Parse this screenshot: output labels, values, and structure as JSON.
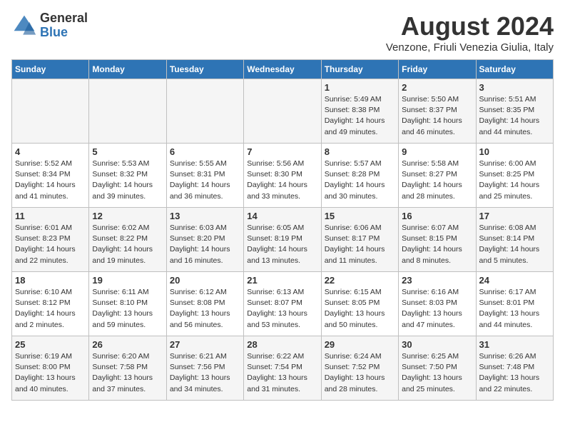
{
  "header": {
    "logo": {
      "line1": "General",
      "line2": "Blue"
    },
    "title": "August 2024",
    "location": "Venzone, Friuli Venezia Giulia, Italy"
  },
  "days_of_week": [
    "Sunday",
    "Monday",
    "Tuesday",
    "Wednesday",
    "Thursday",
    "Friday",
    "Saturday"
  ],
  "weeks": [
    [
      {
        "day": "",
        "info": ""
      },
      {
        "day": "",
        "info": ""
      },
      {
        "day": "",
        "info": ""
      },
      {
        "day": "",
        "info": ""
      },
      {
        "day": "1",
        "info": "Sunrise: 5:49 AM\nSunset: 8:38 PM\nDaylight: 14 hours\nand 49 minutes."
      },
      {
        "day": "2",
        "info": "Sunrise: 5:50 AM\nSunset: 8:37 PM\nDaylight: 14 hours\nand 46 minutes."
      },
      {
        "day": "3",
        "info": "Sunrise: 5:51 AM\nSunset: 8:35 PM\nDaylight: 14 hours\nand 44 minutes."
      }
    ],
    [
      {
        "day": "4",
        "info": "Sunrise: 5:52 AM\nSunset: 8:34 PM\nDaylight: 14 hours\nand 41 minutes."
      },
      {
        "day": "5",
        "info": "Sunrise: 5:53 AM\nSunset: 8:32 PM\nDaylight: 14 hours\nand 39 minutes."
      },
      {
        "day": "6",
        "info": "Sunrise: 5:55 AM\nSunset: 8:31 PM\nDaylight: 14 hours\nand 36 minutes."
      },
      {
        "day": "7",
        "info": "Sunrise: 5:56 AM\nSunset: 8:30 PM\nDaylight: 14 hours\nand 33 minutes."
      },
      {
        "day": "8",
        "info": "Sunrise: 5:57 AM\nSunset: 8:28 PM\nDaylight: 14 hours\nand 30 minutes."
      },
      {
        "day": "9",
        "info": "Sunrise: 5:58 AM\nSunset: 8:27 PM\nDaylight: 14 hours\nand 28 minutes."
      },
      {
        "day": "10",
        "info": "Sunrise: 6:00 AM\nSunset: 8:25 PM\nDaylight: 14 hours\nand 25 minutes."
      }
    ],
    [
      {
        "day": "11",
        "info": "Sunrise: 6:01 AM\nSunset: 8:23 PM\nDaylight: 14 hours\nand 22 minutes."
      },
      {
        "day": "12",
        "info": "Sunrise: 6:02 AM\nSunset: 8:22 PM\nDaylight: 14 hours\nand 19 minutes."
      },
      {
        "day": "13",
        "info": "Sunrise: 6:03 AM\nSunset: 8:20 PM\nDaylight: 14 hours\nand 16 minutes."
      },
      {
        "day": "14",
        "info": "Sunrise: 6:05 AM\nSunset: 8:19 PM\nDaylight: 14 hours\nand 13 minutes."
      },
      {
        "day": "15",
        "info": "Sunrise: 6:06 AM\nSunset: 8:17 PM\nDaylight: 14 hours\nand 11 minutes."
      },
      {
        "day": "16",
        "info": "Sunrise: 6:07 AM\nSunset: 8:15 PM\nDaylight: 14 hours\nand 8 minutes."
      },
      {
        "day": "17",
        "info": "Sunrise: 6:08 AM\nSunset: 8:14 PM\nDaylight: 14 hours\nand 5 minutes."
      }
    ],
    [
      {
        "day": "18",
        "info": "Sunrise: 6:10 AM\nSunset: 8:12 PM\nDaylight: 14 hours\nand 2 minutes."
      },
      {
        "day": "19",
        "info": "Sunrise: 6:11 AM\nSunset: 8:10 PM\nDaylight: 13 hours\nand 59 minutes."
      },
      {
        "day": "20",
        "info": "Sunrise: 6:12 AM\nSunset: 8:08 PM\nDaylight: 13 hours\nand 56 minutes."
      },
      {
        "day": "21",
        "info": "Sunrise: 6:13 AM\nSunset: 8:07 PM\nDaylight: 13 hours\nand 53 minutes."
      },
      {
        "day": "22",
        "info": "Sunrise: 6:15 AM\nSunset: 8:05 PM\nDaylight: 13 hours\nand 50 minutes."
      },
      {
        "day": "23",
        "info": "Sunrise: 6:16 AM\nSunset: 8:03 PM\nDaylight: 13 hours\nand 47 minutes."
      },
      {
        "day": "24",
        "info": "Sunrise: 6:17 AM\nSunset: 8:01 PM\nDaylight: 13 hours\nand 44 minutes."
      }
    ],
    [
      {
        "day": "25",
        "info": "Sunrise: 6:19 AM\nSunset: 8:00 PM\nDaylight: 13 hours\nand 40 minutes."
      },
      {
        "day": "26",
        "info": "Sunrise: 6:20 AM\nSunset: 7:58 PM\nDaylight: 13 hours\nand 37 minutes."
      },
      {
        "day": "27",
        "info": "Sunrise: 6:21 AM\nSunset: 7:56 PM\nDaylight: 13 hours\nand 34 minutes."
      },
      {
        "day": "28",
        "info": "Sunrise: 6:22 AM\nSunset: 7:54 PM\nDaylight: 13 hours\nand 31 minutes."
      },
      {
        "day": "29",
        "info": "Sunrise: 6:24 AM\nSunset: 7:52 PM\nDaylight: 13 hours\nand 28 minutes."
      },
      {
        "day": "30",
        "info": "Sunrise: 6:25 AM\nSunset: 7:50 PM\nDaylight: 13 hours\nand 25 minutes."
      },
      {
        "day": "31",
        "info": "Sunrise: 6:26 AM\nSunset: 7:48 PM\nDaylight: 13 hours\nand 22 minutes."
      }
    ]
  ]
}
